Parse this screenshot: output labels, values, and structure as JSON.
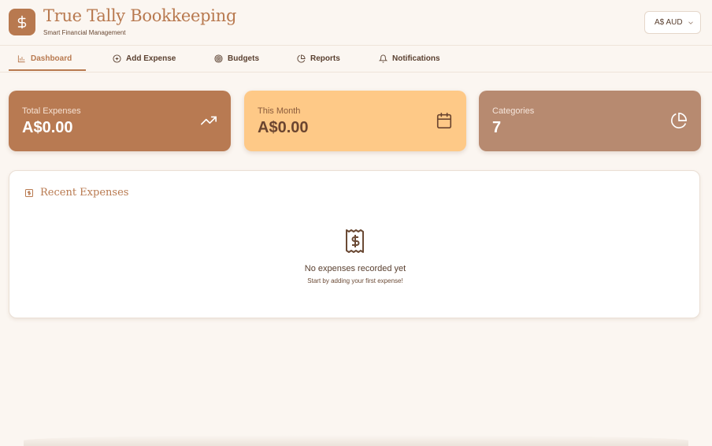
{
  "header": {
    "title": "True Tally Bookkeeping",
    "subtitle": "Smart Financial Management",
    "logo_icon": "dollar-icon",
    "currency": "A$ AUD"
  },
  "nav": {
    "tabs": [
      {
        "label": "Dashboard",
        "icon": "bar-chart-icon",
        "active": true
      },
      {
        "label": "Add Expense",
        "icon": "plus-circle-icon",
        "active": false
      },
      {
        "label": "Budgets",
        "icon": "target-icon",
        "active": false
      },
      {
        "label": "Reports",
        "icon": "pie-chart-icon",
        "active": false
      },
      {
        "label": "Notifications",
        "icon": "bell-icon",
        "active": false
      }
    ]
  },
  "stats": [
    {
      "label": "Total Expenses",
      "value": "A$0.00",
      "icon": "trending-up-icon",
      "color": "#b87a52"
    },
    {
      "label": "This Month",
      "value": "A$0.00",
      "icon": "calendar-icon",
      "color": "#fec987"
    },
    {
      "label": "Categories",
      "value": "7",
      "icon": "pie-chart-icon",
      "color": "#b78a70"
    }
  ],
  "recent": {
    "title": "Recent Expenses",
    "empty_title": "No expenses recorded yet",
    "empty_subtitle": "Start by adding your first expense!",
    "icon": "receipt-icon"
  },
  "colors": {
    "accent": "#b8794f",
    "background": "#fbf6f1"
  }
}
